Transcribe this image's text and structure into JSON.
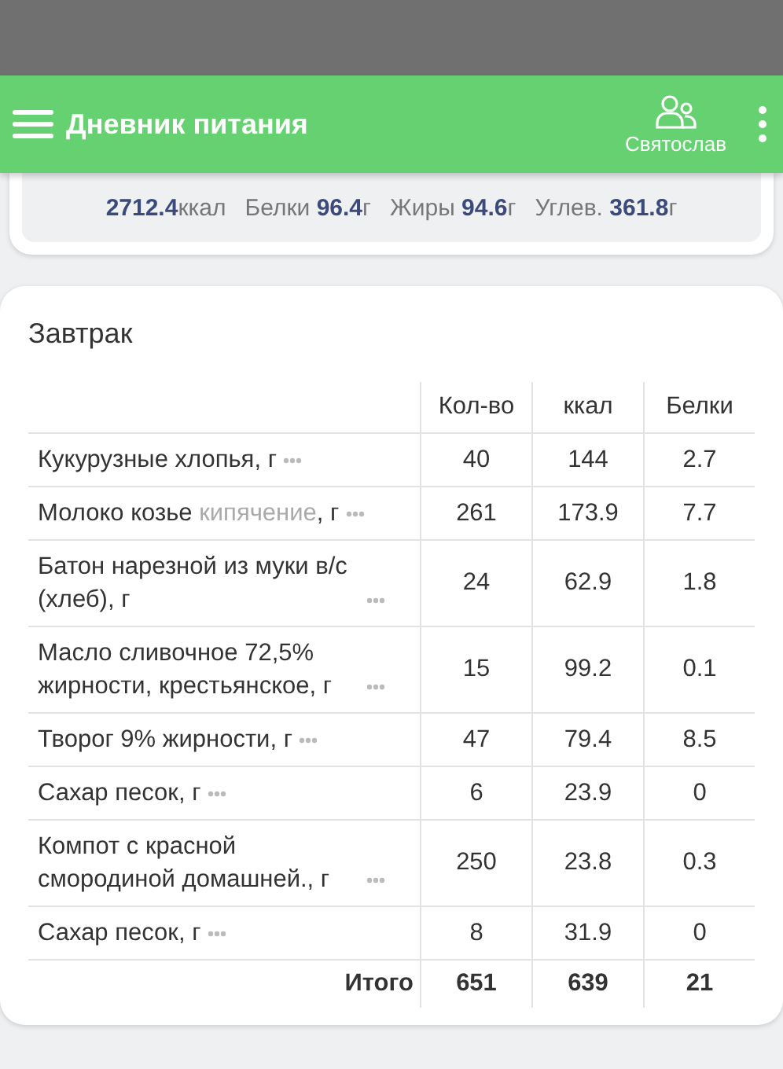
{
  "app_bar": {
    "title": "Дневник питания",
    "user": "Святослав"
  },
  "summary": [
    {
      "value": "2712.4",
      "unit": "ккал"
    },
    {
      "label": "Белки",
      "value": "96.4",
      "unit": "г"
    },
    {
      "label": "Жиры",
      "value": "94.6",
      "unit": "г"
    },
    {
      "label": "Углев.",
      "value": "361.8",
      "unit": "г"
    }
  ],
  "meal": {
    "title": "Завтрак",
    "columns": [
      "Кол-во",
      "ккал",
      "Белки"
    ],
    "rows": [
      {
        "name": "Кукурузные хлопья",
        "unit": ", г",
        "cells": [
          "40",
          "144",
          "2.7"
        ]
      },
      {
        "name": "Молоко козье",
        "note": "кипячение",
        "unit": ", г",
        "cells": [
          "261",
          "173.9",
          "7.7"
        ]
      },
      {
        "name": "Батон нарезной из муки в/с (хлеб)",
        "unit": ", г",
        "cells": [
          "24",
          "62.9",
          "1.8"
        ]
      },
      {
        "name": "Масло сливочное 72,5% жирности, крестьянское",
        "unit": ", г",
        "cells": [
          "15",
          "99.2",
          "0.1"
        ]
      },
      {
        "name": "Творог 9% жирности",
        "unit": ", г",
        "cells": [
          "47",
          "79.4",
          "8.5"
        ]
      },
      {
        "name": "Сахар песок",
        "unit": ", г",
        "cells": [
          "6",
          "23.9",
          "0"
        ]
      },
      {
        "name": "Компот с красной смородиной домашней.",
        "unit": ", г",
        "cells": [
          "250",
          "23.8",
          "0.3"
        ]
      },
      {
        "name": "Сахар песок",
        "unit": ", г",
        "cells": [
          "8",
          "31.9",
          "0"
        ]
      }
    ],
    "total": {
      "label": "Итого",
      "cells": [
        "651",
        "639",
        "21"
      ]
    }
  }
}
